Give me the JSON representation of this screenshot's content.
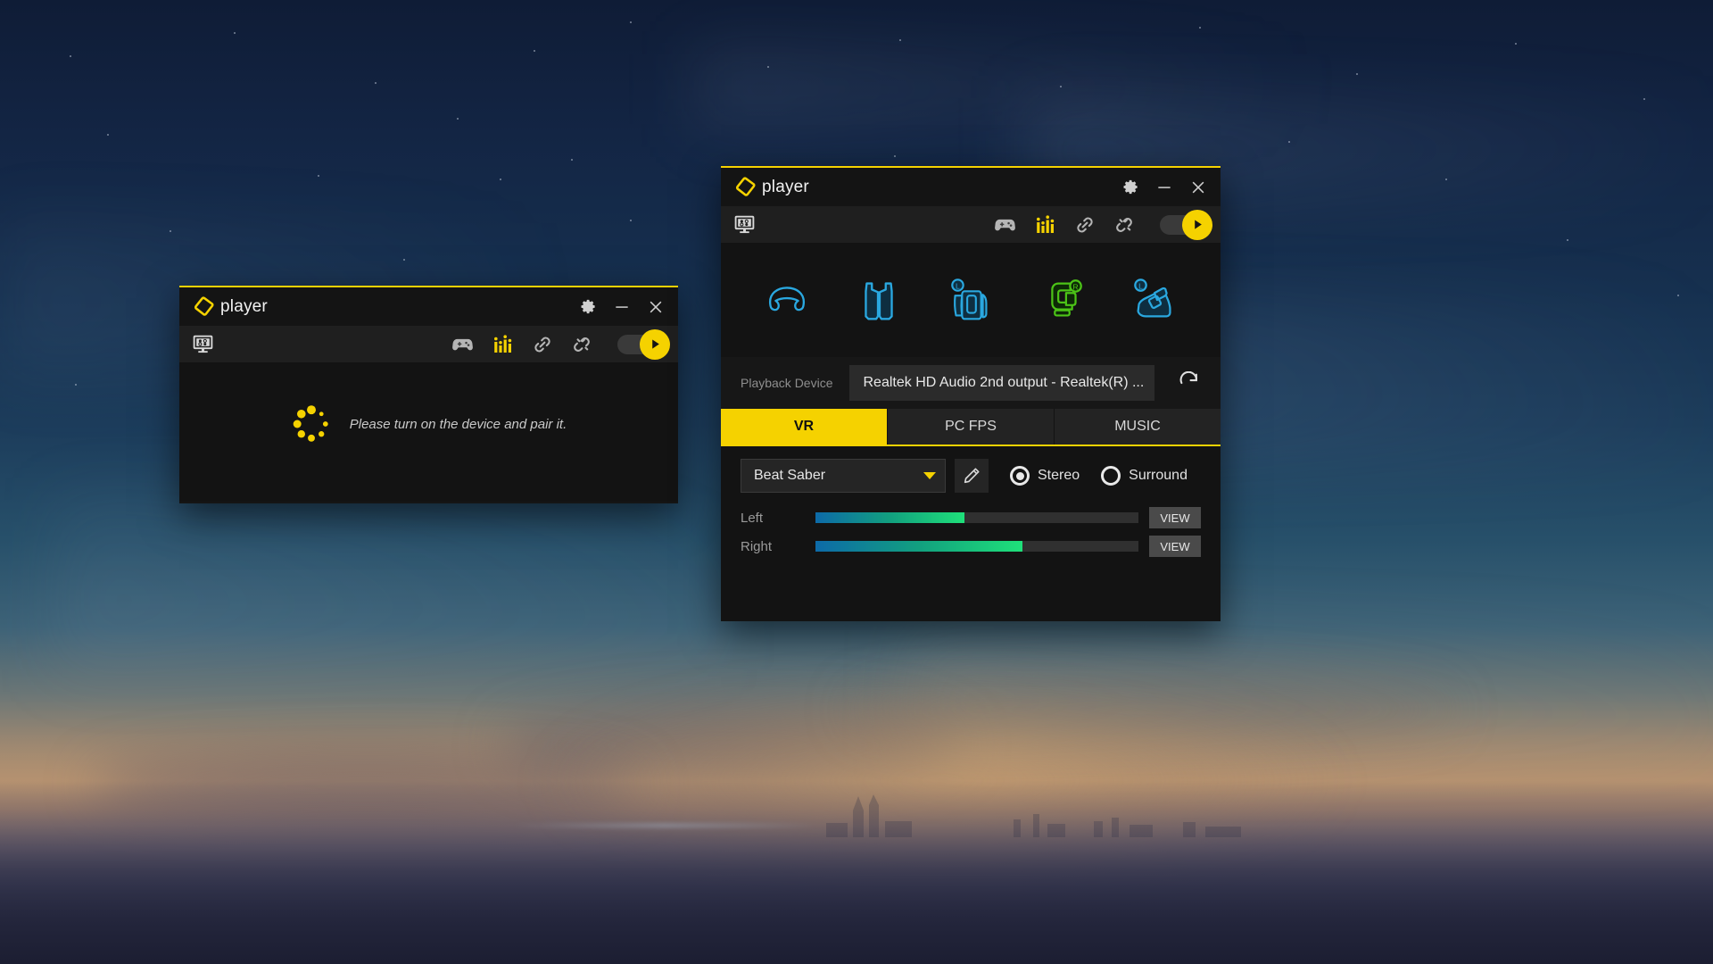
{
  "app": {
    "brand_name": "player",
    "accent_color": "#f5d200"
  },
  "pairing_window": {
    "title": "player",
    "titlebar_buttons": [
      {
        "name": "settings",
        "icon": "gear-icon"
      },
      {
        "name": "minimize",
        "icon": "minimize-icon"
      },
      {
        "name": "close",
        "icon": "close-icon"
      }
    ],
    "toolbar": {
      "display_icon": "monitor-icon",
      "icons": [
        {
          "name": "gamepad",
          "icon": "gamepad-icon",
          "color": "#b5b5b5"
        },
        {
          "name": "equalizer",
          "icon": "equalizer-icon",
          "color": "#f5d200"
        },
        {
          "name": "link",
          "icon": "link-icon",
          "color": "#b5b5b5"
        },
        {
          "name": "unlink",
          "icon": "broken-link-icon",
          "color": "#b5b5b5"
        }
      ],
      "power_toggle_state": "on"
    },
    "status_message": "Please turn on the device and pair it.",
    "spinner_color": "#f5d200"
  },
  "main_window": {
    "title": "player",
    "titlebar_buttons": [
      {
        "name": "settings",
        "icon": "gear-icon"
      },
      {
        "name": "minimize",
        "icon": "minimize-icon"
      },
      {
        "name": "close",
        "icon": "close-icon"
      }
    ],
    "toolbar": {
      "display_icon": "monitor-icon",
      "icons": [
        {
          "name": "gamepad",
          "icon": "gamepad-icon",
          "color": "#b5b5b5"
        },
        {
          "name": "equalizer",
          "icon": "equalizer-icon",
          "color": "#f5d200"
        },
        {
          "name": "link",
          "icon": "link-icon",
          "color": "#b5b5b5"
        },
        {
          "name": "unlink",
          "icon": "broken-link-icon",
          "color": "#b5b5b5"
        }
      ],
      "power_toggle_state": "on"
    },
    "devices": [
      {
        "name": "headband",
        "icon": "headband-icon",
        "status_color": "#2aa8e0",
        "side": ""
      },
      {
        "name": "vest",
        "icon": "vest-icon",
        "status_color": "#2aa8e0",
        "side": ""
      },
      {
        "name": "arm-sleeve-left",
        "icon": "arm-sleeve-icon",
        "status_color": "#2aa8e0",
        "side": "L"
      },
      {
        "name": "glove-right",
        "icon": "glove-icon",
        "status_color": "#4cc417",
        "side": "R"
      },
      {
        "name": "foot-left",
        "icon": "foot-icon",
        "status_color": "#2aa8e0",
        "side": "L"
      }
    ],
    "playback": {
      "label": "Playback Device",
      "value": "Realtek HD Audio 2nd output - Realtek(R) ...",
      "refresh_icon": "refresh-icon"
    },
    "tabs": [
      {
        "label": "VR",
        "active": true
      },
      {
        "label": "PC FPS",
        "active": false
      },
      {
        "label": "MUSIC",
        "active": false
      }
    ],
    "vr_panel": {
      "game": "Beat Saber",
      "edit_icon": "pencil-icon",
      "audio_modes": [
        {
          "label": "Stereo",
          "selected": true
        },
        {
          "label": "Surround",
          "selected": false
        }
      ],
      "meters": [
        {
          "label": "Left",
          "value": 46,
          "button": "VIEW"
        },
        {
          "label": "Right",
          "value": 64,
          "button": "VIEW"
        }
      ]
    }
  }
}
